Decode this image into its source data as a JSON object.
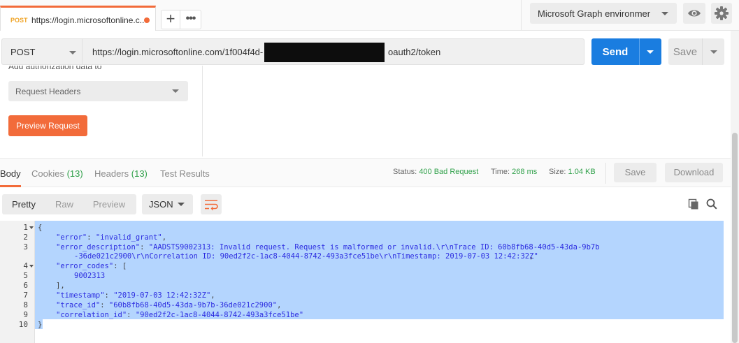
{
  "tabs": [
    {
      "method": "POST",
      "title": "https://login.microsoftonline.c..."
    }
  ],
  "tab_actions": {
    "add": "+",
    "more": "•••"
  },
  "environment": {
    "selected": "Microsoft Graph environmer"
  },
  "request": {
    "method": "POST",
    "url_start": "https://login.microsoftonline.com/1f004f4d-",
    "url_end": "oauth2/token",
    "send_label": "Send",
    "save_label": "Save"
  },
  "auth": {
    "cut_label": "Add authorization data to",
    "add_to": "Request Headers",
    "preview_label": "Preview Request"
  },
  "response": {
    "tabs": [
      {
        "label": "Body",
        "count": ""
      },
      {
        "label": "Cookies",
        "count": "(13)"
      },
      {
        "label": "Headers",
        "count": "(13)"
      },
      {
        "label": "Test Results",
        "count": ""
      }
    ],
    "status_label": "Status:",
    "status_value": "400 Bad Request",
    "time_label": "Time:",
    "time_value": "268 ms",
    "size_label": "Size:",
    "size_value": "1.04 KB",
    "save_label": "Save",
    "download_label": "Download"
  },
  "body_toolbar": {
    "views": [
      "Pretty",
      "Raw",
      "Preview"
    ],
    "format": "JSON"
  },
  "code": {
    "line_numbers": [
      "1",
      "2",
      "3",
      "",
      "4",
      "5",
      "6",
      "7",
      "8",
      "9",
      "10"
    ],
    "open_brace": "{",
    "close_brace": "}",
    "error_key": "\"error\"",
    "error_val": "\"invalid_grant\"",
    "desc_key": "\"error_description\"",
    "desc_val_1": "\"AADSTS9002313: Invalid request. Request is malformed or invalid.\\r\\nTrace ID: 60b8fb68-40d5-43da-9b7b",
    "desc_val_2": "-36de021c2900\\r\\nCorrelation ID: 90ed2f2c-1ac8-4044-8742-493a3fce51be\\r\\nTimestamp: 2019-07-03 12:42:32Z\"",
    "codes_key": "\"error_codes\"",
    "codes_val": "9002313",
    "ts_key": "\"timestamp\"",
    "ts_val": "\"2019-07-03 12:42:32Z\"",
    "trace_key": "\"trace_id\"",
    "trace_val": "\"60b8fb68-40d5-43da-9b7b-36de021c2900\"",
    "corr_key": "\"correlation_id\"",
    "corr_val": "\"90ed2f2c-1ac8-4044-8742-493a3fce51be\""
  },
  "colors": {
    "accent": "#f26b3a",
    "send": "#1a7de0",
    "status_ok_text": "#31a14b",
    "selection": "#b4d5fe"
  }
}
